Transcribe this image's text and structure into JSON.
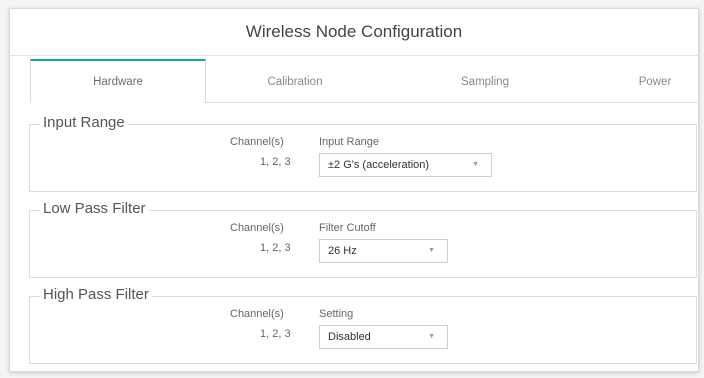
{
  "window": {
    "title": "Wireless Node Configuration"
  },
  "tabs": [
    {
      "label": "Hardware",
      "active": true
    },
    {
      "label": "Calibration",
      "active": false
    },
    {
      "label": "Sampling",
      "active": false
    },
    {
      "label": "Power",
      "active": false
    }
  ],
  "sections": {
    "input_range": {
      "legend": "Input Range",
      "channels_header": "Channel(s)",
      "channels_value": "1, 2, 3",
      "field_label": "Input Range",
      "selected": "±2 G's (acceleration)"
    },
    "low_pass": {
      "legend": "Low Pass Filter",
      "channels_header": "Channel(s)",
      "channels_value": "1, 2, 3",
      "field_label": "Filter Cutoff",
      "selected": "26 Hz"
    },
    "high_pass": {
      "legend": "High Pass Filter",
      "channels_header": "Channel(s)",
      "channels_value": "1, 2, 3",
      "field_label": "Setting",
      "selected": "Disabled"
    }
  },
  "icons": {
    "dropdown": "chevron-down-icon",
    "caret_glyph": "▼"
  },
  "colors": {
    "active_tab_accent": "#1aa99a"
  }
}
